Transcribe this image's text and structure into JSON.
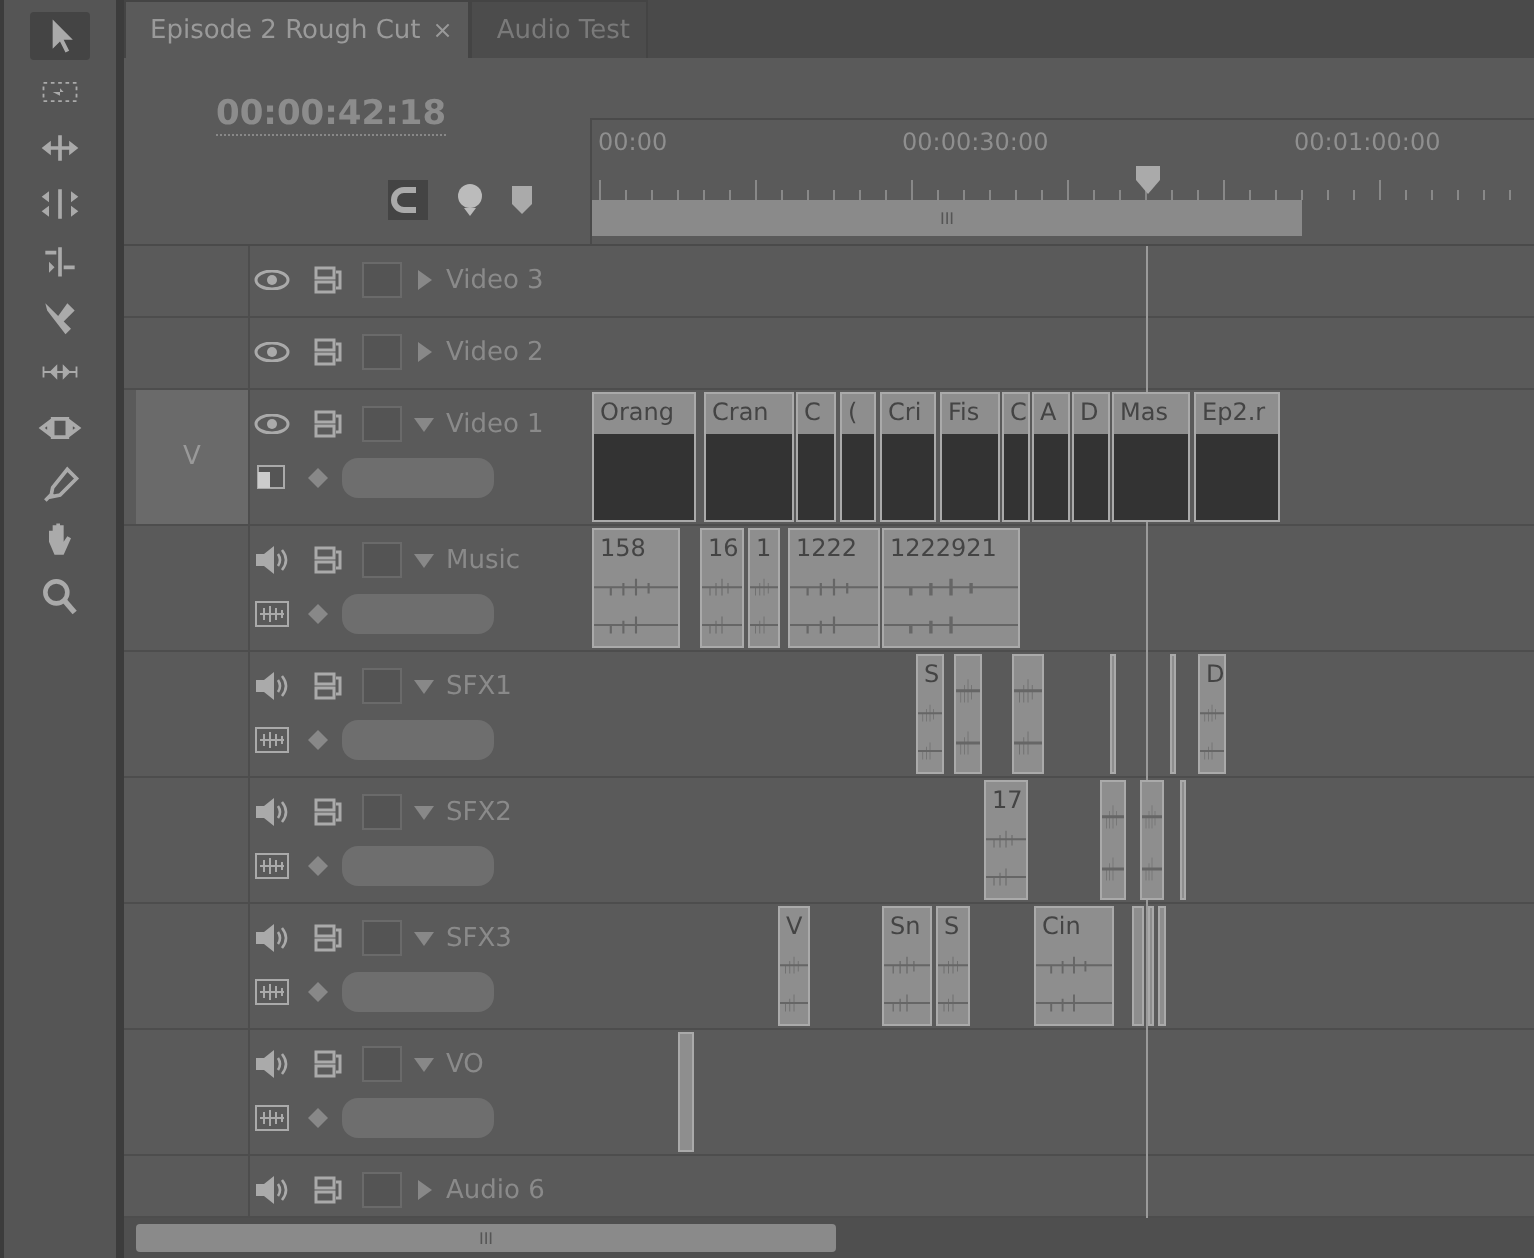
{
  "tabs": [
    {
      "label": "Episode 2 Rough Cut",
      "selected": true,
      "close": "×"
    },
    {
      "label": "Audio Test",
      "selected": false
    }
  ],
  "timecode": "00:00:42:18",
  "ruler": {
    "labels": [
      "00:00",
      "00:00:30:00",
      "00:01:00:00"
    ],
    "work_area_grip": "III"
  },
  "tracks": [
    {
      "name": "Video 3",
      "kind": "video",
      "expanded": false
    },
    {
      "name": "Video 2",
      "kind": "video",
      "expanded": false
    },
    {
      "name": "Video 1",
      "kind": "video",
      "expanded": true,
      "target": "V",
      "clips": [
        {
          "kind": "titled",
          "label": "Orang"
        },
        {
          "kind": "titled",
          "label": "Cran"
        },
        {
          "kind": "titled",
          "label": "C"
        },
        {
          "kind": "titled",
          "label": "("
        },
        {
          "kind": "titled",
          "label": "Cri"
        },
        {
          "kind": "titled",
          "label": "Fis"
        },
        {
          "kind": "titled",
          "label": "C"
        },
        {
          "kind": "titled",
          "label": "A"
        },
        {
          "kind": "titled",
          "label": "D"
        },
        {
          "kind": "titled",
          "label": "Mas"
        },
        {
          "kind": "titled",
          "label": "Ep2.r"
        }
      ]
    },
    {
      "name": "Music",
      "kind": "audio",
      "expanded": true,
      "clips": [
        {
          "kind": "titled",
          "label": "158"
        },
        {
          "kind": "titled",
          "label": "16"
        },
        {
          "kind": "titled",
          "label": "1"
        },
        {
          "kind": "titled",
          "label": "1222"
        },
        {
          "kind": "titled",
          "label": "1222921"
        }
      ]
    },
    {
      "name": "SFX1",
      "kind": "audio",
      "expanded": true,
      "clips": [
        {
          "kind": "titled",
          "label": "S"
        },
        {
          "kind": "untitled"
        },
        {
          "kind": "untitled"
        },
        {
          "kind": "untitled"
        },
        {
          "kind": "untitled"
        },
        {
          "kind": "titled",
          "label": "D"
        }
      ]
    },
    {
      "name": "SFX2",
      "kind": "audio",
      "expanded": true,
      "clips": [
        {
          "kind": "titled",
          "label": "17"
        },
        {
          "kind": "untitled"
        },
        {
          "kind": "untitled"
        },
        {
          "kind": "untitled"
        }
      ]
    },
    {
      "name": "SFX3",
      "kind": "audio",
      "expanded": true,
      "clips": [
        {
          "kind": "titled",
          "label": "V"
        },
        {
          "kind": "titled",
          "label": "Sn"
        },
        {
          "kind": "titled",
          "label": "S"
        },
        {
          "kind": "titled",
          "label": "Cin"
        },
        {
          "kind": "untitled"
        },
        {
          "kind": "untitled"
        },
        {
          "kind": "untitled"
        }
      ]
    },
    {
      "name": "VO",
      "kind": "audio",
      "expanded": true,
      "clips": [
        {
          "kind": "untitled"
        }
      ]
    },
    {
      "name": "Audio 6",
      "kind": "audio",
      "expanded": false
    }
  ],
  "scrollbar": {
    "grip": "III"
  }
}
